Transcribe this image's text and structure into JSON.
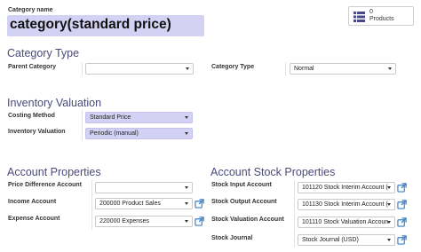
{
  "form": {
    "name_label": "Category name",
    "name_value": "category(standard price)"
  },
  "products_button": {
    "count": "0",
    "label": "Products"
  },
  "category_type": {
    "title": "Category Type",
    "parent_label": "Parent Category",
    "parent_value": "",
    "type_label": "Category Type",
    "type_value": "Normal"
  },
  "inventory": {
    "title": "Inventory Valuation",
    "costing_label": "Costing Method",
    "costing_value": "Standard Price",
    "valuation_label": "Inventory Valuation",
    "valuation_value": "Periodic (manual)"
  },
  "account_props": {
    "title": "Account Properties",
    "price_diff_label": "Price Difference Account",
    "price_diff_value": "",
    "income_label": "Income Account",
    "income_value": "200000 Product Sales",
    "expense_label": "Expense Account",
    "expense_value": "220000 Expenses"
  },
  "stock_props": {
    "title": "Account Stock Properties",
    "input_label": "Stock Input Account",
    "input_value": "101120 Stock Interim Account (",
    "output_label": "Stock Output Account",
    "output_value": "101130 Stock Interim Account (",
    "valuation_label": "Stock Valuation Account",
    "valuation_value": "101110 Stock Valuation Accoun",
    "journal_label": "Stock Journal",
    "journal_value": "Stock Journal (USD)"
  },
  "colors": {
    "required_bg": "#d4d2f4",
    "section_title": "#4b4a7a",
    "link": "#3a7fc1"
  },
  "icons": [
    "list-icon",
    "caret-down-icon",
    "external-link-icon"
  ]
}
